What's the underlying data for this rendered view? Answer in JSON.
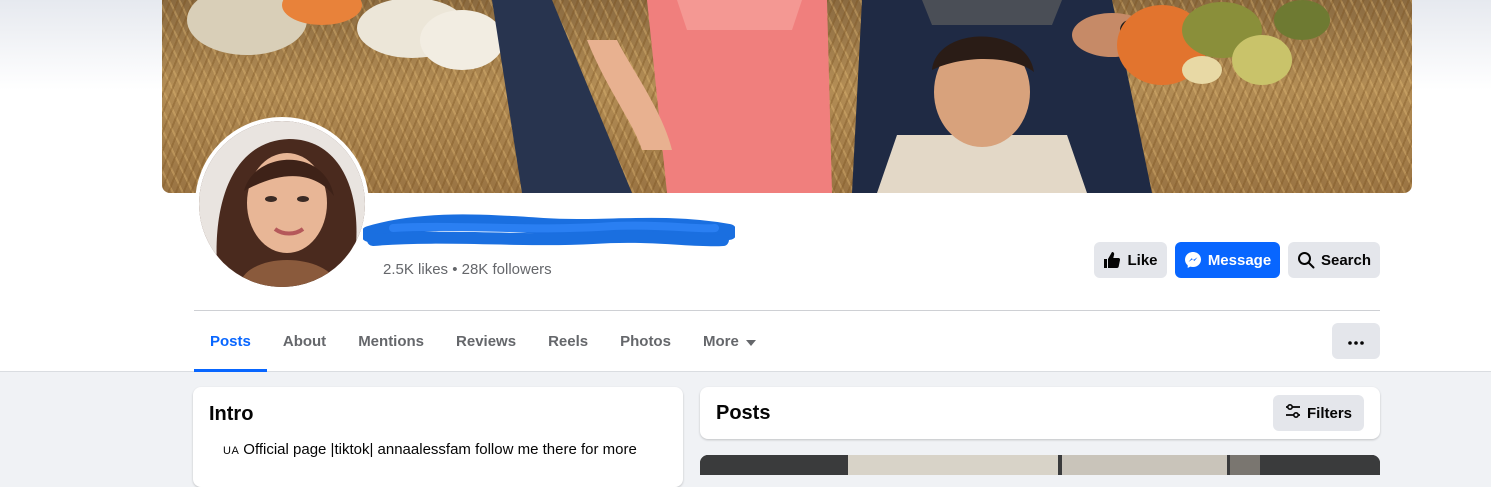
{
  "profile": {
    "stats": "2.5K likes • 28K followers"
  },
  "actions": {
    "like_label": "Like",
    "message_label": "Message",
    "search_label": "Search"
  },
  "tabs": [
    {
      "label": "Posts",
      "active": true
    },
    {
      "label": "About",
      "active": false
    },
    {
      "label": "Mentions",
      "active": false
    },
    {
      "label": "Reviews",
      "active": false
    },
    {
      "label": "Reels",
      "active": false
    },
    {
      "label": "Photos",
      "active": false
    },
    {
      "label": "More",
      "active": false
    }
  ],
  "intro": {
    "title": "Intro",
    "flag": "UA",
    "bio": "Official page |tiktok| annaalessfam follow me there for more"
  },
  "posts": {
    "title": "Posts",
    "filters_label": "Filters"
  },
  "colors": {
    "accent": "#0866ff",
    "button_gray": "#e4e6eb",
    "page_bg": "#f0f2f5",
    "redaction": "#1a6fe0"
  }
}
